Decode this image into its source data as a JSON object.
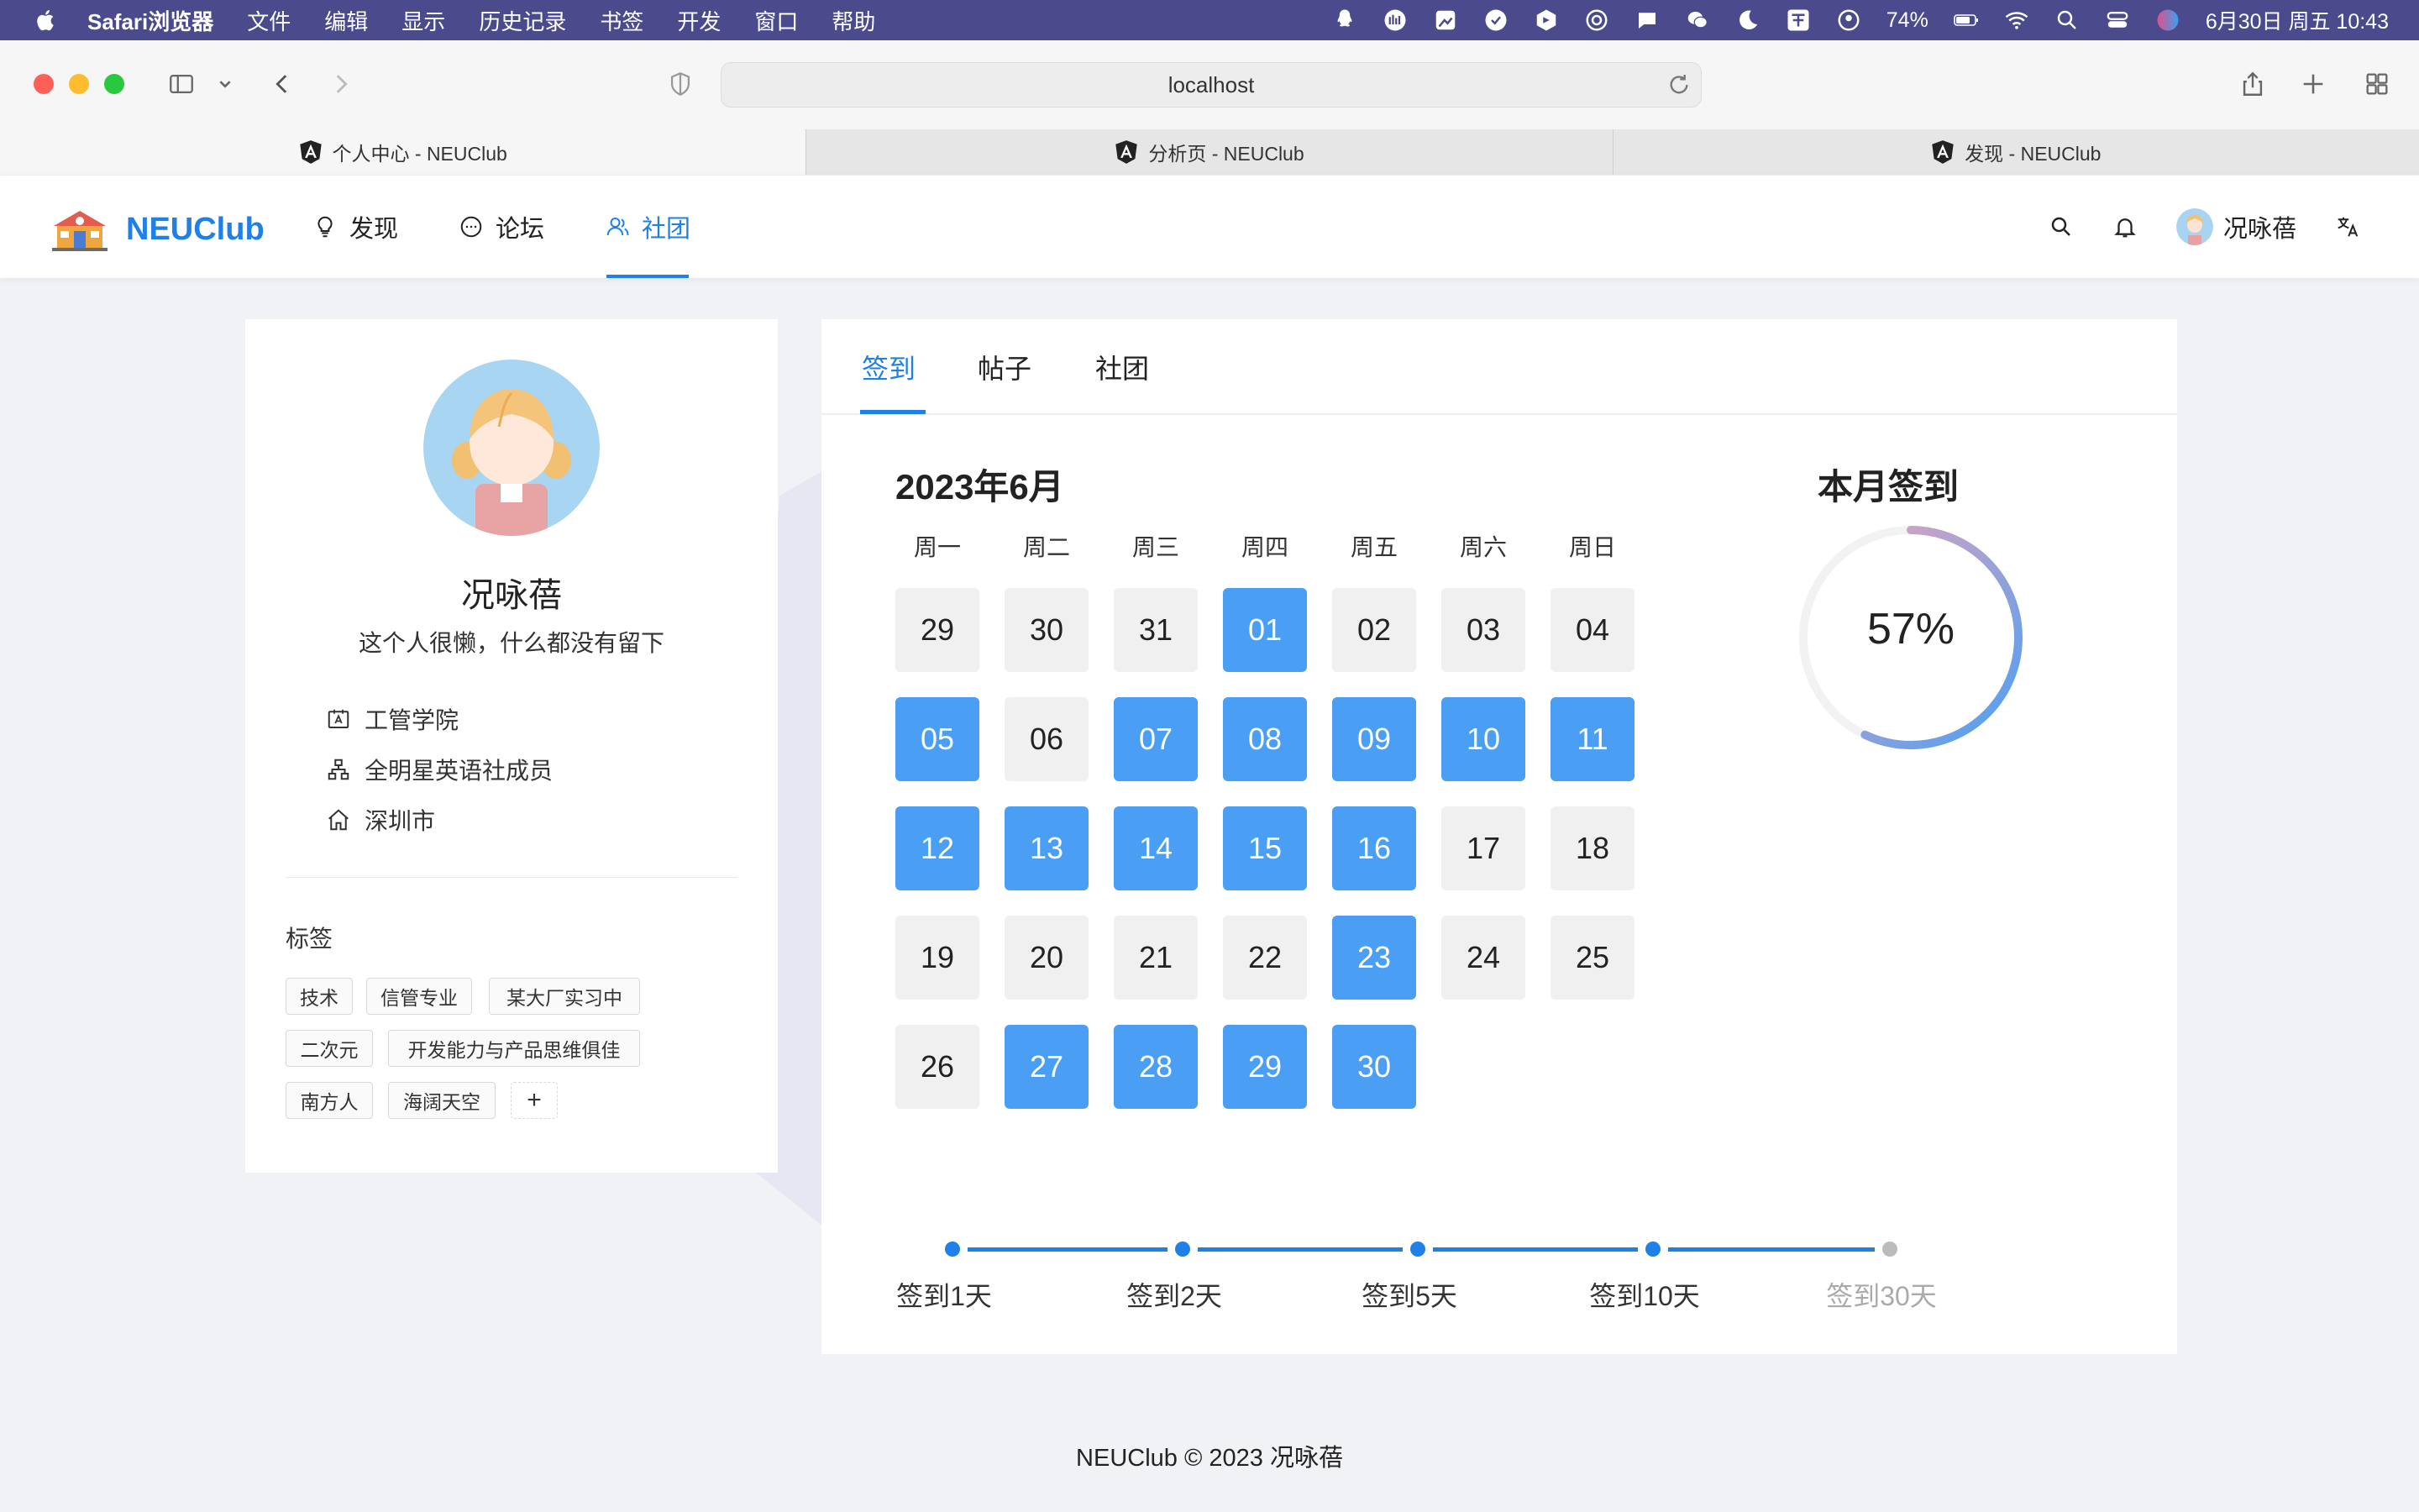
{
  "menubar": {
    "app_name": "Safari浏览器",
    "items": [
      "文件",
      "编辑",
      "显示",
      "历史记录",
      "书签",
      "开发",
      "窗口",
      "帮助"
    ],
    "battery": "74%",
    "datetime": "6月30日 周五  10:43"
  },
  "browser": {
    "url": "localhost",
    "tabs": [
      {
        "title": "个人中心 - NEUClub",
        "active": true
      },
      {
        "title": "分析页 - NEUClub",
        "active": false
      },
      {
        "title": "发现 - NEUClub",
        "active": false
      }
    ]
  },
  "app": {
    "brand": "NEUClub",
    "nav": [
      {
        "label": "发现",
        "icon": "lightbulb-icon",
        "active": false
      },
      {
        "label": "论坛",
        "icon": "chat-icon",
        "active": false
      },
      {
        "label": "社团",
        "icon": "team-icon",
        "active": true
      }
    ],
    "user_name": "况咏蓓"
  },
  "profile": {
    "name": "况咏蓓",
    "bio": "这个人很懒，什么都没有留下",
    "info": [
      {
        "icon": "id-card-icon",
        "text": "工管学院"
      },
      {
        "icon": "org-chart-icon",
        "text": "全明星英语社成员"
      },
      {
        "icon": "home-icon",
        "text": "深圳市"
      }
    ],
    "tags_title": "标签",
    "tags": [
      "技术",
      "信管专业",
      "某大厂实习中",
      "二次元",
      "开发能力与产品思维俱佳",
      "南方人",
      "海阔天空"
    ],
    "add_tag": "+"
  },
  "main": {
    "tabs": [
      {
        "label": "签到",
        "active": true
      },
      {
        "label": "帖子",
        "active": false
      },
      {
        "label": "社团",
        "active": false
      }
    ],
    "calendar": {
      "title": "2023年6月",
      "weekdays": [
        "周一",
        "周二",
        "周三",
        "周四",
        "周五",
        "周六",
        "周日"
      ],
      "days": [
        {
          "d": "29",
          "on": false
        },
        {
          "d": "30",
          "on": false
        },
        {
          "d": "31",
          "on": false
        },
        {
          "d": "01",
          "on": true
        },
        {
          "d": "02",
          "on": false
        },
        {
          "d": "03",
          "on": false
        },
        {
          "d": "04",
          "on": false
        },
        {
          "d": "05",
          "on": true
        },
        {
          "d": "06",
          "on": false
        },
        {
          "d": "07",
          "on": true
        },
        {
          "d": "08",
          "on": true
        },
        {
          "d": "09",
          "on": true
        },
        {
          "d": "10",
          "on": true
        },
        {
          "d": "11",
          "on": true
        },
        {
          "d": "12",
          "on": true
        },
        {
          "d": "13",
          "on": true
        },
        {
          "d": "14",
          "on": true
        },
        {
          "d": "15",
          "on": true
        },
        {
          "d": "16",
          "on": true
        },
        {
          "d": "17",
          "on": false
        },
        {
          "d": "18",
          "on": false
        },
        {
          "d": "19",
          "on": false
        },
        {
          "d": "20",
          "on": false
        },
        {
          "d": "21",
          "on": false
        },
        {
          "d": "22",
          "on": false
        },
        {
          "d": "23",
          "on": true
        },
        {
          "d": "24",
          "on": false
        },
        {
          "d": "25",
          "on": false
        },
        {
          "d": "26",
          "on": false
        },
        {
          "d": "27",
          "on": true
        },
        {
          "d": "28",
          "on": true
        },
        {
          "d": "29",
          "on": true
        },
        {
          "d": "30",
          "on": true
        }
      ]
    },
    "monthly": {
      "title": "本月签到",
      "percent_text": "57%",
      "percent": 57
    },
    "milestones": [
      {
        "label": "签到1天",
        "reached": true
      },
      {
        "label": "签到2天",
        "reached": true
      },
      {
        "label": "签到5天",
        "reached": true
      },
      {
        "label": "签到10天",
        "reached": true
      },
      {
        "label": "签到30天",
        "reached": false
      }
    ]
  },
  "footer": "NEUClub © 2023 况咏蓓",
  "colors": {
    "accent": "#1f80e8",
    "checked": "#4a9ff5",
    "menubar": "#4b4a8c"
  }
}
